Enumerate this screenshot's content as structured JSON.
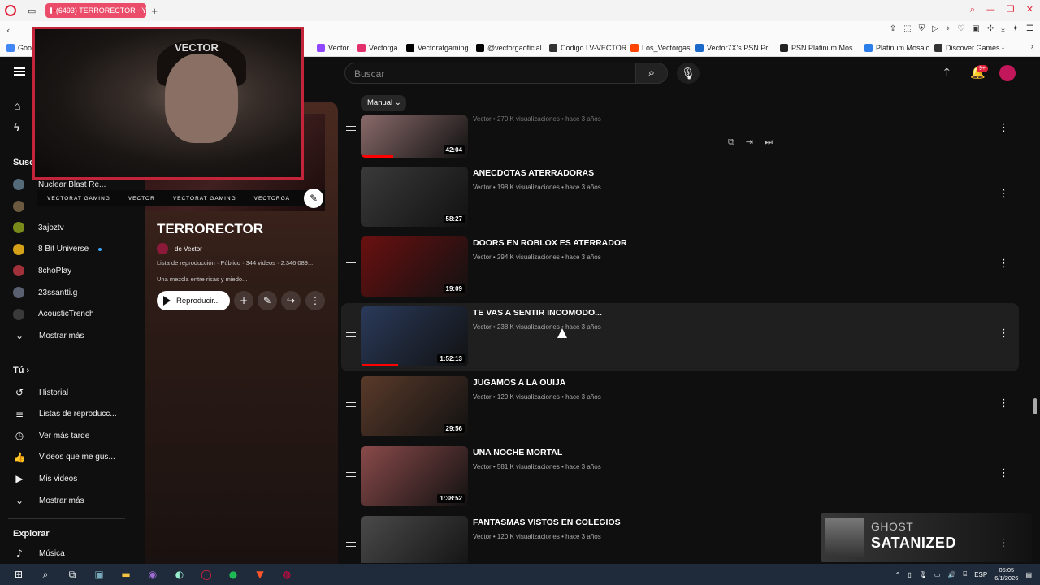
{
  "browser": {
    "tab_title": "(6493) TERRORECTOR - Y",
    "window_controls": [
      "search-icon",
      "minimize-icon",
      "restore-icon",
      "close-icon"
    ],
    "bookmarks": [
      {
        "label": "Goog",
        "color": "#4285f4"
      },
      {
        "label": "Vector",
        "color": "#9146ff"
      },
      {
        "label": "Vectorga",
        "color": "#e1306c"
      },
      {
        "label": "Vectoratgaming",
        "color": "#000000"
      },
      {
        "label": "@vectorgaoficial",
        "color": "#000000"
      },
      {
        "label": "Codigo LV-VECTOR",
        "color": "#333333"
      },
      {
        "label": "Los_Vectorgas",
        "color": "#ff4500"
      },
      {
        "label": "Vector7X's PSN Pr...",
        "color": "#1b6ac9"
      },
      {
        "label": "PSN Platinum Mos...",
        "color": "#222222"
      },
      {
        "label": "Platinum Mosaic",
        "color": "#2b7de9"
      },
      {
        "label": "Discover Games -...",
        "color": "#333333"
      }
    ]
  },
  "header": {
    "search_placeholder": "Buscar",
    "notification_badge": "9+"
  },
  "sidebar": {
    "subs_title": "Susc",
    "subscriptions": [
      {
        "name": "Nuclear Blast Re...",
        "color": "#556b7a",
        "new": false
      },
      {
        "name": "",
        "color": "#6b5a40",
        "new": false
      },
      {
        "name": "3ajoztv",
        "color": "#7a8a1a",
        "new": false
      },
      {
        "name": "8 Bit Universe",
        "color": "#d4a017",
        "new": true
      },
      {
        "name": "8choPlay",
        "color": "#a0303a",
        "new": false
      },
      {
        "name": "23ssantti.g",
        "color": "#5a6070",
        "new": false
      },
      {
        "name": "AcousticTrench",
        "color": "#3a3a3a",
        "new": false
      }
    ],
    "show_more": "Mostrar más",
    "you_title": "Tú",
    "you_items": [
      {
        "label": "Historial",
        "icon": "history-icon"
      },
      {
        "label": "Listas de reproducc...",
        "icon": "playlists-icon"
      },
      {
        "label": "Ver más tarde",
        "icon": "watch-later-icon"
      },
      {
        "label": "Videos que me gus...",
        "icon": "like-icon"
      },
      {
        "label": "Mis videos",
        "icon": "my-videos-icon"
      }
    ],
    "show_more_2": "Mostrar más",
    "explore_title": "Explorar",
    "explore_items": [
      {
        "label": "Música",
        "icon": "music-icon"
      }
    ]
  },
  "playlist": {
    "socials": [
      "VECTORAT GAMING",
      "VECTOR",
      "VECTORAT GAMING",
      "VECTORGA"
    ],
    "title": "TERRORECTOR",
    "author": "de Vector",
    "meta": "Lista de reproducción · Público · 344 videos · 2.346.089...",
    "description": "Una mezcla entre risas y miedo...",
    "play_label": "Reproducir..."
  },
  "webcam": {
    "label": "VECTOR"
  },
  "list": {
    "sort_label": "Manual",
    "videos": [
      {
        "title": "",
        "meta": "Vector • 270 K visualizaciones • hace 3 años",
        "duration": "42:04",
        "progress": 0.3,
        "thumb": "#8a6a6a"
      },
      {
        "title": "ANECDOTAS ATERRADORAS",
        "meta": "Vector • 198 K visualizaciones • hace 3 años",
        "duration": "58:27",
        "progress": 0,
        "thumb": "#3a3a3a"
      },
      {
        "title": "DOORS EN ROBLOX ES ATERRADOR",
        "meta": "Vector • 294 K visualizaciones • hace 3 años",
        "duration": "19:09",
        "progress": 0,
        "thumb": "#6a1010"
      },
      {
        "title": "TE VAS A SENTIR INCOMODO...",
        "meta": "Vector • 238 K visualizaciones • hace 3 años",
        "duration": "1:52:13",
        "progress": 0.35,
        "thumb": "#2a3a5a"
      },
      {
        "title": "JUGAMOS A LA OUIJA",
        "meta": "Vector • 129 K visualizaciones • hace 3 años",
        "duration": "29:56",
        "progress": 0,
        "thumb": "#5a3a2a"
      },
      {
        "title": "UNA NOCHE MORTAL",
        "meta": "Vector • 581 K visualizaciones • hace 3 años",
        "duration": "1:38:52",
        "progress": 0,
        "thumb": "#8a4a4a"
      },
      {
        "title": "FANTASMAS VISTOS EN COLEGIOS",
        "meta": "Vector • 120 K visualizaciones • hace 3 años",
        "duration": "",
        "progress": 0,
        "thumb": "#4a4a4a"
      }
    ]
  },
  "now_playing": {
    "artist": "GHOST",
    "song": "SATANIZED"
  },
  "taskbar": {
    "lang": "ESP",
    "time": "05:05",
    "date": "6/1/2026"
  }
}
